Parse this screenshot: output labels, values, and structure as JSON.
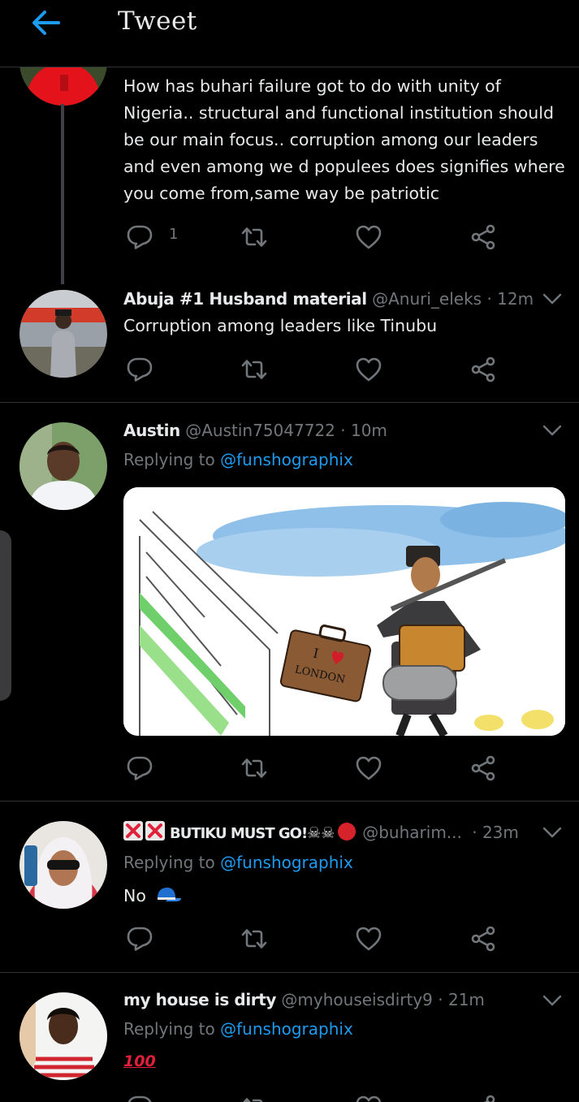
{
  "header": {
    "title": "Tweet"
  },
  "tweets": [
    {
      "body": "How has buhari failure got to do with unity of Nigeria.. structural and functional institution should be our main focus.. corruption among our leaders and even among we d populees does signifies where you come from,same way be patriotic",
      "reply_count": "1"
    },
    {
      "name": "Abuja #1 Husband material",
      "handle": "@Anuri_eleks",
      "time": "· 12m",
      "body": "Corruption among leaders like Tinubu"
    },
    {
      "name": "Austin",
      "handle": "@Austin75047722",
      "time": "· 10m",
      "replying_prefix": "Replying to",
      "replying_handle": "@funshographix",
      "media": {
        "bag_text_1": "I",
        "bag_text_2": "LONDON"
      }
    },
    {
      "name": "BUTIKU MUST GO!",
      "handle": "@buharim...",
      "time": "· 23m",
      "replying_prefix": "Replying to",
      "replying_handle": "@funshographix",
      "body": "No"
    },
    {
      "name": "my house is dirty",
      "handle": "@myhouseisdirty9",
      "time": "· 21m",
      "replying_prefix": "Replying to",
      "replying_handle": "@funshographix",
      "body": "100"
    }
  ],
  "colors": {
    "background": "#000000",
    "link": "#1d9bf0",
    "muted": "#71767b",
    "divider": "#2f3336"
  },
  "icons": [
    "back-arrow-icon",
    "reply-icon",
    "retweet-icon",
    "like-icon",
    "share-icon",
    "chevron-down-icon",
    "cross-mark-icon",
    "skull-crossbones-icon",
    "ogre-icon",
    "billed-cap-icon",
    "hundred-points-icon"
  ]
}
